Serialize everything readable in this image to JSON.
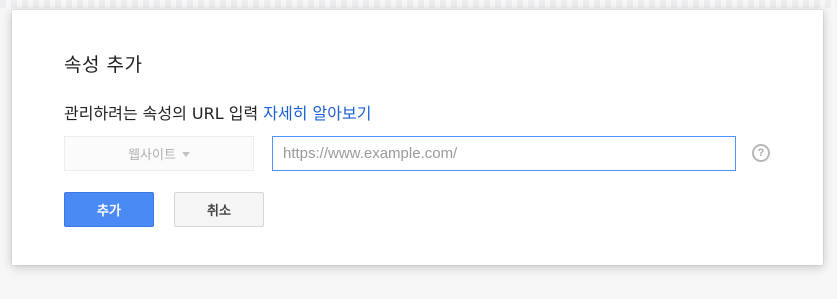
{
  "dialog": {
    "title": "속성 추가",
    "description": "관리하려는 속성의 URL 입력",
    "learn_more_link": "자세히 알아보기",
    "property_type": {
      "selected": "웹사이트",
      "icon": "caret-down-icon"
    },
    "url_field": {
      "value": "",
      "placeholder": "https://www.example.com/"
    },
    "help": {
      "icon": "help-circle-icon",
      "glyph": "?"
    },
    "buttons": {
      "add": "추가",
      "cancel": "취소"
    },
    "colors": {
      "primary": "#4a8af4",
      "link": "#1a5fd6",
      "focus_border": "#4d90fe"
    }
  }
}
